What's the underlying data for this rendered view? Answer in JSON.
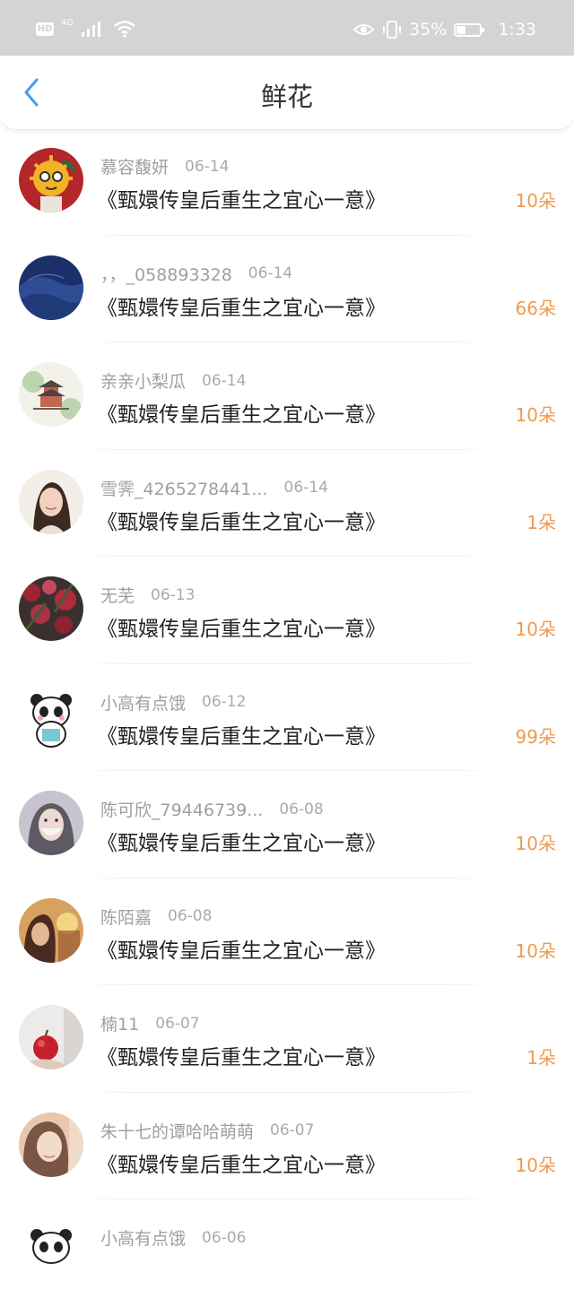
{
  "status_bar": {
    "network_badge": "HD",
    "network_type": "4G",
    "battery_percent": "35%",
    "time": "1:33"
  },
  "header": {
    "title": "鲜花",
    "back_icon": "chevron-left-icon"
  },
  "colors": {
    "accent": "#4a9de8",
    "count_orange": "#ee9a4f",
    "status_bar_bg": "#d4d4d4",
    "name_gray": "#9f9f9f"
  },
  "items": [
    {
      "name": "慕容馥妍",
      "date": "06-14",
      "book": "《甄嬛传皇后重生之宜心一意》",
      "count": "10朵",
      "avatar": "cartoon-sun-avatar"
    },
    {
      "name": "，，_058893328",
      "date": "06-14",
      "book": "《甄嬛传皇后重生之宜心一意》",
      "count": "66朵",
      "avatar": "blue-dunes-avatar"
    },
    {
      "name": "亲亲小梨瓜",
      "date": "06-14",
      "book": "《甄嬛传皇后重生之宜心一意》",
      "count": "10朵",
      "avatar": "pagoda-painting-avatar"
    },
    {
      "name": "雪霁_4265278441...",
      "date": "06-14",
      "book": "《甄嬛传皇后重生之宜心一意》",
      "count": "1朵",
      "avatar": "woman-portrait-avatar"
    },
    {
      "name": "无芜",
      "date": "06-13",
      "book": "《甄嬛传皇后重生之宜心一意》",
      "count": "10朵",
      "avatar": "red-flowers-avatar"
    },
    {
      "name": "小高有点饿",
      "date": "06-12",
      "book": "《甄嬛传皇后重生之宜心一意》",
      "count": "99朵",
      "avatar": "panda-avatar"
    },
    {
      "name": "陈可欣_79446739...",
      "date": "06-08",
      "book": "《甄嬛传皇后重生之宜心一意》",
      "count": "10朵",
      "avatar": "masked-girl-avatar"
    },
    {
      "name": "陈陌嘉",
      "date": "06-08",
      "book": "《甄嬛传皇后重生之宜心一意》",
      "count": "10朵",
      "avatar": "sunset-girl-avatar"
    },
    {
      "name": "楠11",
      "date": "06-07",
      "book": "《甄嬛传皇后重生之宜心一意》",
      "count": "1朵",
      "avatar": "apple-avatar"
    },
    {
      "name": "朱十七的谭哈哈萌萌",
      "date": "06-07",
      "book": "《甄嬛传皇后重生之宜心一意》",
      "count": "10朵",
      "avatar": "soft-portrait-avatar"
    },
    {
      "name": "小高有点饿",
      "date": "06-06",
      "book": "",
      "count": "",
      "avatar": "panda-avatar"
    }
  ]
}
